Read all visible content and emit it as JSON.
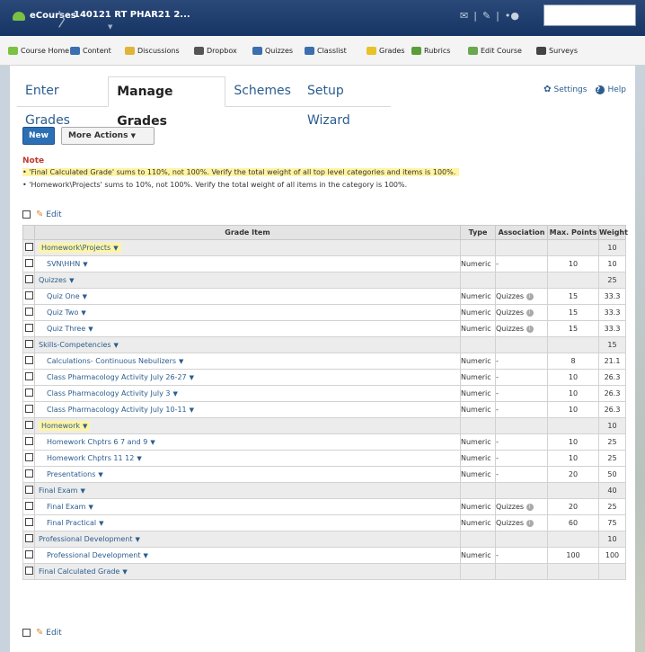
{
  "header": {
    "brand": "eCourses",
    "course": "140121 RT PHAR21 2...",
    "icons": [
      "mail-icon",
      "chat-icon",
      "alerts-icon"
    ]
  },
  "nav": {
    "items": [
      {
        "label": "Course Home",
        "icon": "home-icon"
      },
      {
        "label": "Content",
        "icon": "content-icon"
      },
      {
        "label": "Discussions",
        "icon": "discussions-icon"
      },
      {
        "label": "Dropbox",
        "icon": "dropbox-icon"
      },
      {
        "label": "Quizzes",
        "icon": "quizzes-icon"
      },
      {
        "label": "Classlist",
        "icon": "classlist-icon"
      },
      {
        "label": "Grades",
        "icon": "grades-icon"
      },
      {
        "label": "Rubrics",
        "icon": "rubrics-icon"
      },
      {
        "label": "Edit Course",
        "icon": "edit-course-icon"
      },
      {
        "label": "Surveys",
        "icon": "surveys-icon"
      }
    ]
  },
  "tabs": [
    "Enter Grades",
    "Manage Grades",
    "Schemes",
    "Setup Wizard"
  ],
  "top_links": {
    "settings": "Settings",
    "help": "Help"
  },
  "buttons": {
    "new": "New",
    "more_actions": "More Actions"
  },
  "note": {
    "title": "Note",
    "lines": [
      "'Final Calculated Grade' sums to 110%, not 100%. Verify the total weight of all top level categories and items is 100%.",
      "'Homework\\Projects' sums to 10%, not 100%. Verify the total weight of all items in the category is 100%."
    ]
  },
  "edit_label": "Edit",
  "table": {
    "headers": {
      "grade_item": "Grade Item",
      "type": "Type",
      "association": "Association",
      "max_points": "Max. Points",
      "weight": "Weight"
    },
    "rows": [
      {
        "kind": "cat",
        "name": "Homework\\Projects",
        "highlight": true,
        "type": "",
        "assoc": "",
        "max": "",
        "weight": "10"
      },
      {
        "kind": "item",
        "name": "SVN\\HHN",
        "type": "Numeric",
        "assoc": "-",
        "max": "10",
        "weight": "10"
      },
      {
        "kind": "cat",
        "name": "Quizzes",
        "type": "",
        "assoc": "",
        "max": "",
        "weight": "25"
      },
      {
        "kind": "item",
        "name": "Quiz One",
        "type": "Numeric",
        "assoc": "Quizzes",
        "max": "15",
        "weight": "33.3"
      },
      {
        "kind": "item",
        "name": "Quiz Two",
        "type": "Numeric",
        "assoc": "Quizzes",
        "max": "15",
        "weight": "33.3"
      },
      {
        "kind": "item",
        "name": "Quiz Three",
        "type": "Numeric",
        "assoc": "Quizzes",
        "max": "15",
        "weight": "33.3"
      },
      {
        "kind": "cat",
        "name": "Skills-Competencies",
        "type": "",
        "assoc": "",
        "max": "",
        "weight": "15"
      },
      {
        "kind": "item",
        "name": "Calculations- Continuous Nebulizers",
        "type": "Numeric",
        "assoc": "-",
        "max": "8",
        "weight": "21.1"
      },
      {
        "kind": "item",
        "name": "Class Pharmacology Activity July 26-27",
        "type": "Numeric",
        "assoc": "-",
        "max": "10",
        "weight": "26.3"
      },
      {
        "kind": "item",
        "name": "Class Pharmacology Activity July 3",
        "type": "Numeric",
        "assoc": "-",
        "max": "10",
        "weight": "26.3"
      },
      {
        "kind": "item",
        "name": "Class Pharmacology Activity July 10-11",
        "type": "Numeric",
        "assoc": "-",
        "max": "10",
        "weight": "26.3"
      },
      {
        "kind": "cat",
        "name": "Homework",
        "highlight": true,
        "type": "",
        "assoc": "",
        "max": "",
        "weight": "10"
      },
      {
        "kind": "item",
        "name": "Homework Chptrs 6 7 and 9",
        "type": "Numeric",
        "assoc": "-",
        "max": "10",
        "weight": "25"
      },
      {
        "kind": "item",
        "name": "Homework Chptrs 11 12",
        "type": "Numeric",
        "assoc": "-",
        "max": "10",
        "weight": "25"
      },
      {
        "kind": "item",
        "name": "Presentations",
        "type": "Numeric",
        "assoc": "-",
        "max": "20",
        "weight": "50"
      },
      {
        "kind": "cat",
        "name": "Final Exam",
        "type": "",
        "assoc": "",
        "max": "",
        "weight": "40"
      },
      {
        "kind": "item",
        "name": "Final Exam",
        "type": "Numeric",
        "assoc": "Quizzes",
        "max": "20",
        "weight": "25"
      },
      {
        "kind": "item",
        "name": "Final Practical",
        "type": "Numeric",
        "assoc": "Quizzes",
        "max": "60",
        "weight": "75"
      },
      {
        "kind": "cat",
        "name": "Professional Development",
        "type": "",
        "assoc": "",
        "max": "",
        "weight": "10"
      },
      {
        "kind": "item",
        "name": "Professional Development",
        "type": "Numeric",
        "assoc": "-",
        "max": "100",
        "weight": "100"
      },
      {
        "kind": "cat",
        "name": "Final Calculated Grade",
        "type": "",
        "assoc": "",
        "max": "",
        "weight": ""
      }
    ]
  },
  "colors": {
    "header_bg": "#173564",
    "link": "#2b5d8f",
    "highlight": "#fff4a3",
    "note_title": "#c0392b",
    "new_button": "#2c6fb5"
  }
}
